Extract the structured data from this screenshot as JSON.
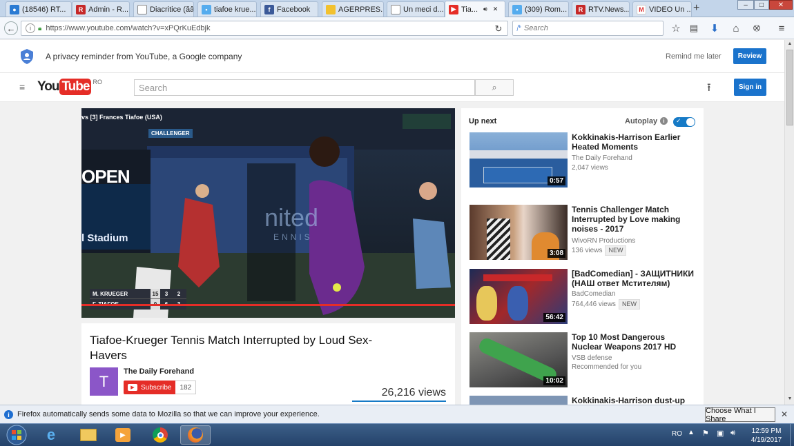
{
  "browser": {
    "tabs": [
      {
        "label": "(18546) RT...",
        "icon": "blue-bird-icon"
      },
      {
        "label": "Admin - R...",
        "icon": "r-logo-icon"
      },
      {
        "label": "Diacritice (ăâîșț...",
        "icon": "blank-page-icon"
      },
      {
        "label": "tiafoe krue...",
        "icon": "twitter-icon"
      },
      {
        "label": "Facebook",
        "icon": "facebook-icon"
      },
      {
        "label": "AGERPRES...",
        "icon": "agerpres-icon"
      },
      {
        "label": "Un meci d...",
        "icon": "blank-page-icon"
      },
      {
        "label": "Tia...",
        "icon": "youtube-icon",
        "active": true
      },
      {
        "label": "(309) Rom...",
        "icon": "twitter-icon"
      },
      {
        "label": "RTV.News...",
        "icon": "r-logo-icon"
      },
      {
        "label": "VIDEO Un ...",
        "icon": "gmail-icon"
      }
    ],
    "new_tab": "+",
    "url": "https://www.youtube.com/watch?v=xPQrKuEdbjk",
    "search_placeholder": "Search"
  },
  "privacy": {
    "text": "A privacy reminder from YouTube, a Google company",
    "remind_label": "Remind me later",
    "review_label": "Review"
  },
  "header": {
    "logo_you": "You",
    "logo_tube": "Tube",
    "country": "RO",
    "search_placeholder": "Search",
    "signin_label": "Sign in"
  },
  "player": {
    "overlay_title": "vs [3] Frances Tiafoe (USA)",
    "brand": "CHALLENGER",
    "sign_open": "OPEN",
    "sign_stadium": "l Stadium",
    "banner_text": "nited",
    "banner_sub": "ENNIS",
    "player1": "M. KRUEGER",
    "p1_game": "15",
    "p1_set1": "3",
    "p1_set2": "2",
    "player2": "F. TIAFOE",
    "p2_game": "0",
    "p2_set1": "6",
    "p2_set2": "3",
    "progress": 1.0
  },
  "video": {
    "title": "Tiafoe-Krueger Tennis Match Interrupted by Loud Sex-Havers",
    "channel_initial": "T",
    "channel_name": "The Daily Forehand",
    "subscribe_label": "Subscribe",
    "subscriber_count": "182",
    "views": "26,216 views"
  },
  "sidebar": {
    "up_next": "Up next",
    "autoplay": "Autoplay",
    "items": [
      {
        "title": "Kokkinakis-Harrison Earlier Heated Moments",
        "channel": "The Daily Forehand",
        "views": "2,047 views",
        "duration": "0:57"
      },
      {
        "title": "Tennis Challenger Match Interrupted by Love making noises - 2017",
        "channel": "WivoRN Productions",
        "views": "136 views",
        "badge": "NEW",
        "duration": "3:08"
      },
      {
        "title": "[BadComedian] - ЗАЩИТНИКИ (НАШ ответ Мстителям)",
        "channel": "BadComedian",
        "views": "764,446 views",
        "badge": "NEW",
        "duration": "56:42"
      },
      {
        "title": "Top 10 Most Dangerous Nuclear Weapons 2017 HD",
        "channel": "VSB defense",
        "views": "Recommended for you",
        "duration": "10:02"
      },
      {
        "title": "Kokkinakis-Harrison dust-up in"
      }
    ]
  },
  "notification": {
    "text": "Firefox automatically sends some data to Mozilla so that we can improve your experience.",
    "button": "Choose What I Share"
  },
  "taskbar": {
    "language": "RO",
    "time": "12:59 PM",
    "date": "4/19/2017"
  }
}
